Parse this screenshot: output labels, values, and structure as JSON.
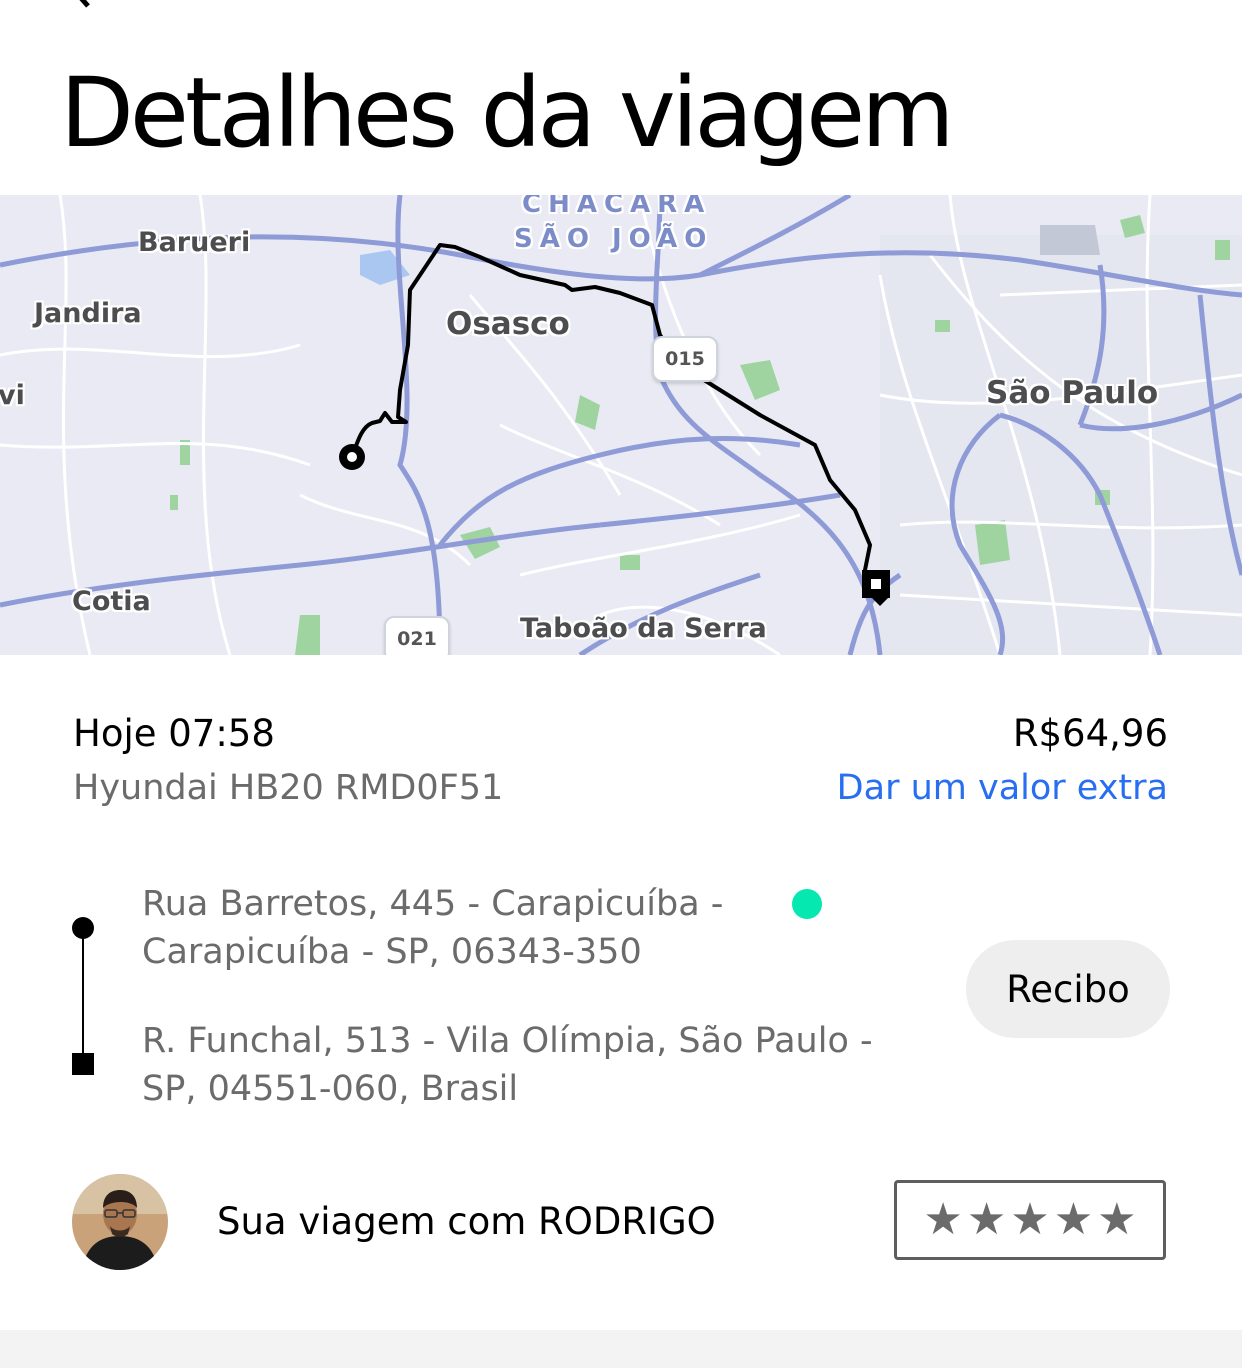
{
  "header": {
    "title": "Detalhes da viagem"
  },
  "map": {
    "labels": {
      "barueri": "Barueri",
      "jandira": "Jandira",
      "osasco": "Osasco",
      "sao_paulo": "São Paulo",
      "cotia": "Cotia",
      "taboao": "Taboão da Serra",
      "chacara": "CHÁCARA",
      "sao_joao": "SÃO JOÃO",
      "left_edge": "vi"
    },
    "route_shields": [
      "015",
      "021"
    ]
  },
  "trip": {
    "time": "Hoje 07:58",
    "vehicle": "Hyundai HB20 RMD0F51",
    "price": "R$64,96",
    "tip_link": "Dar um valor extra",
    "pickup_address": "Rua Barretos, 445 - Carapicuíba - Carapicuíba - SP, 06343-350",
    "dropoff_address": "R. Funchal, 513 - Vila Olímpia, São Paulo - SP, 04551-060, Brasil",
    "receipt_button": "Recibo"
  },
  "driver": {
    "text": "Sua viagem com RODRIGO",
    "rating_stars": [
      "★",
      "★",
      "★",
      "★",
      "★"
    ]
  },
  "colors": {
    "link": "#276ef1",
    "status_dot": "#05e8b0",
    "map_road": "#8e9bd6",
    "route": "#000000"
  }
}
